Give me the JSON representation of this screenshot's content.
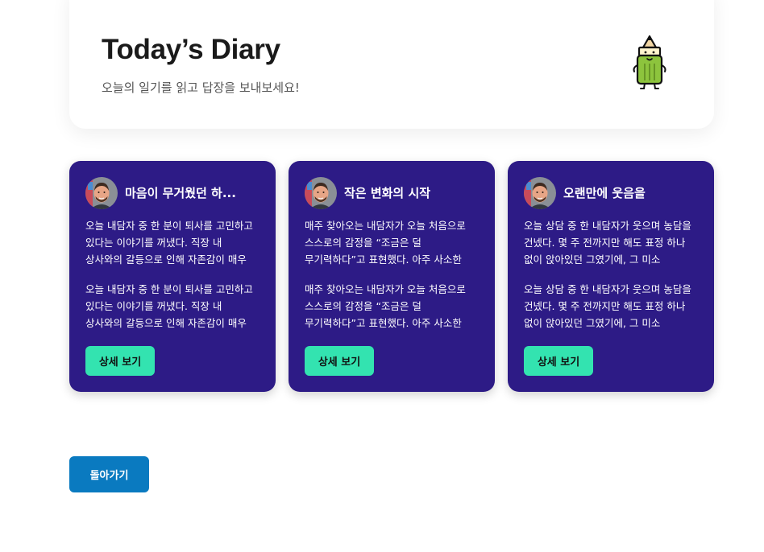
{
  "header": {
    "title": "Today’s Diary",
    "subtitle": "오늘의 일기를 읽고 답장을 보내보세요!",
    "mascot_icon": "pencil-mascot-icon"
  },
  "cards": [
    {
      "title": "마음이 무거웠던 하...",
      "avatar_icon": "user-avatar",
      "paragraphs": [
        "오늘 내담자 중 한 분이 퇴사를 고민하고 있다는 이야기를 꺼냈다. 직장 내 상사와의 갈등으로 인해 자존감이 매우",
        "오늘 내담자 중 한 분이 퇴사를 고민하고 있다는 이야기를 꺼냈다. 직장 내 상사와의 갈등으로 인해 자존감이 매우"
      ],
      "button_label": "상세 보기"
    },
    {
      "title": "작은 변화의 시작",
      "avatar_icon": "user-avatar",
      "paragraphs": [
        "매주 찾아오는 내담자가 오늘 처음으로 스스로의 감정을 “조금은 덜 무기력하다”고 표현했다. 아주 사소한 말이",
        "매주 찾아오는 내담자가 오늘 처음으로 스스로의 감정을 “조금은 덜 무기력하다”고 표현했다. 아주 사소한 말이"
      ],
      "button_label": "상세 보기"
    },
    {
      "title": "오랜만에 웃음을",
      "avatar_icon": "user-avatar",
      "paragraphs": [
        "오늘 상담 중 한 내담자가 웃으며 농담을 건넸다. 몇 주 전까지만 해도 표정 하나 없이 앉아있던 그였기에, 그 미소",
        "오늘 상담 중 한 내담자가 웃으며 농담을 건넸다. 몇 주 전까지만 해도 표정 하나 없이 앉아있던 그였기에, 그 미소"
      ],
      "button_label": "상세 보기"
    }
  ],
  "back_button": "돌아가기",
  "colors": {
    "card_bg": "#2d1b86",
    "button_green": "#33e3b0",
    "back_button_blue": "#0a7ac0"
  }
}
